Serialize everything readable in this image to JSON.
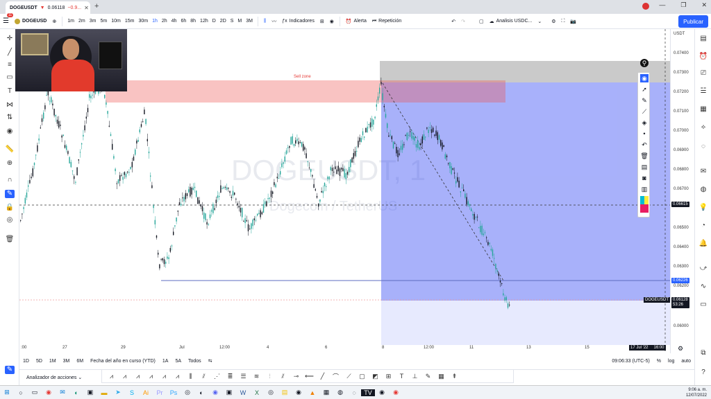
{
  "browser": {
    "tab_title": "DOGEUSDT",
    "tab_price": "0.06118",
    "tab_change": "−0.9...",
    "notif_badge": "11"
  },
  "topbar": {
    "symbol": "DOGEUSD",
    "intervals": [
      "1m",
      "2m",
      "3m",
      "5m",
      "10m",
      "15m",
      "30m",
      "1h",
      "2h",
      "4h",
      "6h",
      "8h",
      "12h",
      "D",
      "2D",
      "S",
      "M",
      "3M"
    ],
    "active_interval": "1h",
    "indicators": "Indicadores",
    "alert": "Alerta",
    "replay": "Repetición",
    "layout_name": "Analisis USDC...",
    "publish": "Publicar"
  },
  "chart": {
    "sell_zone_label": "Sell zone",
    "watermark_symbol": "DOGEUSDT, 1",
    "watermark_desc": "Dogecoin / TetherUS",
    "symbol_tag": "DOGEUSDT",
    "last_price": "0.06128",
    "countdown": "53:26",
    "crosshair_price": "0.06615",
    "line_price": "0.06226",
    "date_tag": "17 Jul '22",
    "date_tag_time": "16:00",
    "currency": "USDT"
  },
  "price_axis": [
    "0.07400",
    "0.07300",
    "0.07200",
    "0.07100",
    "0.07000",
    "0.06900",
    "0.06800",
    "0.06700",
    "0.06500",
    "0.06400",
    "0.06300",
    "0.06200",
    "0.06000"
  ],
  "time_axis": [
    ":00",
    "27",
    "29",
    "Jul",
    "12:00",
    "4",
    "6",
    "8",
    "12:00",
    "11",
    "13",
    "15"
  ],
  "bottom": {
    "ranges": [
      "1D",
      "5D",
      "1M",
      "3M",
      "6M",
      "Fecha del año en curso (YTD)",
      "1A",
      "5A",
      "Todos"
    ],
    "clock": "09:06:33 (UTC-5)",
    "pct": "%",
    "log": "log",
    "auto": "auto",
    "screener": "Analizador de acciones"
  },
  "taskbar": {
    "time": "9:06 a. m.",
    "date": "12/07/2022"
  },
  "colors": {
    "accent": "#2962ff",
    "sell_zone": "#f4a6a6",
    "short_target": "#5c6ef8",
    "stop_zone": "#9e9e9e",
    "up_candle": "#26a69a",
    "down_candle": "#131722"
  }
}
